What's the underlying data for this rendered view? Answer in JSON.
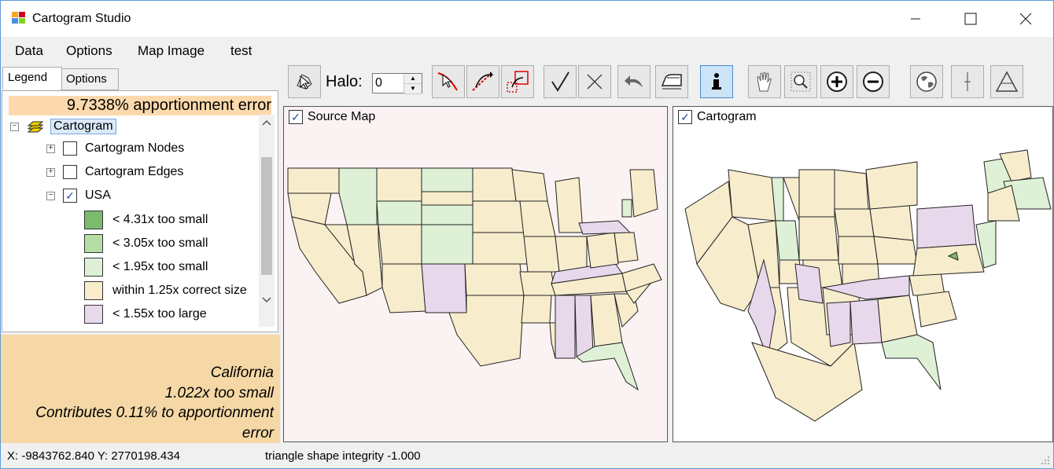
{
  "window": {
    "title": "Cartogram Studio",
    "min": "—",
    "max": "☐",
    "close": "✕"
  },
  "menu": [
    "Data",
    "Options",
    "Map Image",
    "test"
  ],
  "tabs": {
    "legend": "Legend",
    "options": "Options"
  },
  "legend": {
    "error_banner": "9.7338% apportionment error",
    "root": "Cartogram",
    "nodes": "Cartogram Nodes",
    "edges": "Cartogram Edges",
    "usa": "USA",
    "classes": [
      {
        "label": "< 4.31x too small",
        "color": "#7dbb6c"
      },
      {
        "label": "< 3.05x too small",
        "color": "#b4dfa4"
      },
      {
        "label": "< 1.95x too small",
        "color": "#def1d6"
      },
      {
        "label": "within 1.25x correct size",
        "color": "#f7eccc"
      },
      {
        "label": "< 1.55x too large",
        "color": "#e8d8ec"
      }
    ]
  },
  "info": {
    "name": "California",
    "ratio": "1.022x too small",
    "contrib": "Contributes 0.11% to apportionment",
    "contrib2": "error"
  },
  "toolbar": {
    "halo_label": "Halo:",
    "halo_value": "0",
    "icons": [
      "pointer-map-icon",
      "node-edit-icon",
      "curve-edit-icon",
      "box-select-icon",
      "check-icon",
      "cancel-icon",
      "undo-icon",
      "iron-icon",
      "info-icon",
      "pan-icon",
      "zoom-region-icon",
      "zoom-in-icon",
      "zoom-out-icon",
      "globe-icon",
      "center-line-icon",
      "triangle-icon"
    ]
  },
  "source_map": {
    "label": "Source Map",
    "bg": "#fbf3f3"
  },
  "cartogram_map": {
    "label": "Cartogram",
    "bg": "#ffffff"
  },
  "status": {
    "coords": "X: -9843762.840 Y: 2770198.434",
    "message": "triangle shape integrity -1.000"
  },
  "colors": {
    "within": "#f7eccc",
    "small1": "#def1d6",
    "small2": "#b4dfa4",
    "large": "#e8d8ec",
    "banner": "#fcd9ac",
    "info_bg": "#f5d8a5"
  }
}
